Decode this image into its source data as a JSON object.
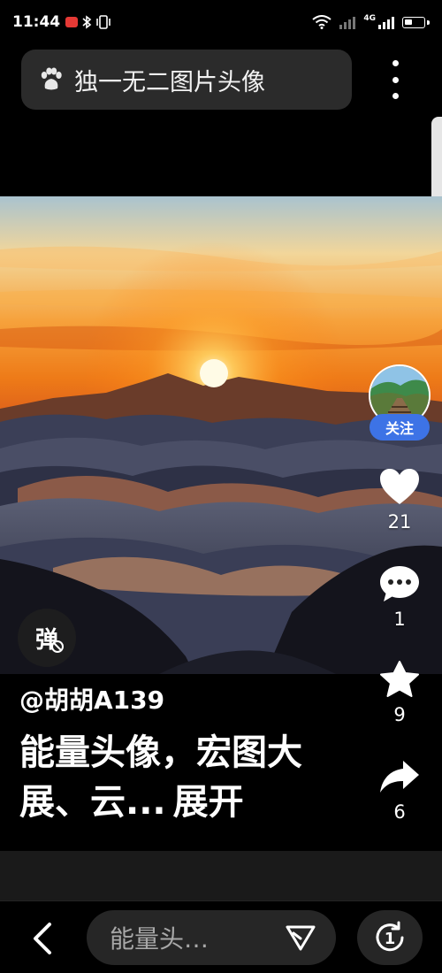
{
  "status_bar": {
    "time": "11:44",
    "network": "4G"
  },
  "search": {
    "query": "独一无二图片头像"
  },
  "video": {
    "author": "@胡胡A139",
    "caption": "能量头像，宏图大展、云...",
    "expand_label": "展开",
    "danmaku_label": "弹"
  },
  "actions": {
    "follow_label": "关注",
    "likes": "21",
    "comments": "1",
    "favorites": "9",
    "shares": "6"
  },
  "bottom_bar": {
    "search_text": "能量头…",
    "one_label": "1"
  },
  "colors": {
    "follow": "#3d73e6",
    "accent_red": "#e53935"
  }
}
